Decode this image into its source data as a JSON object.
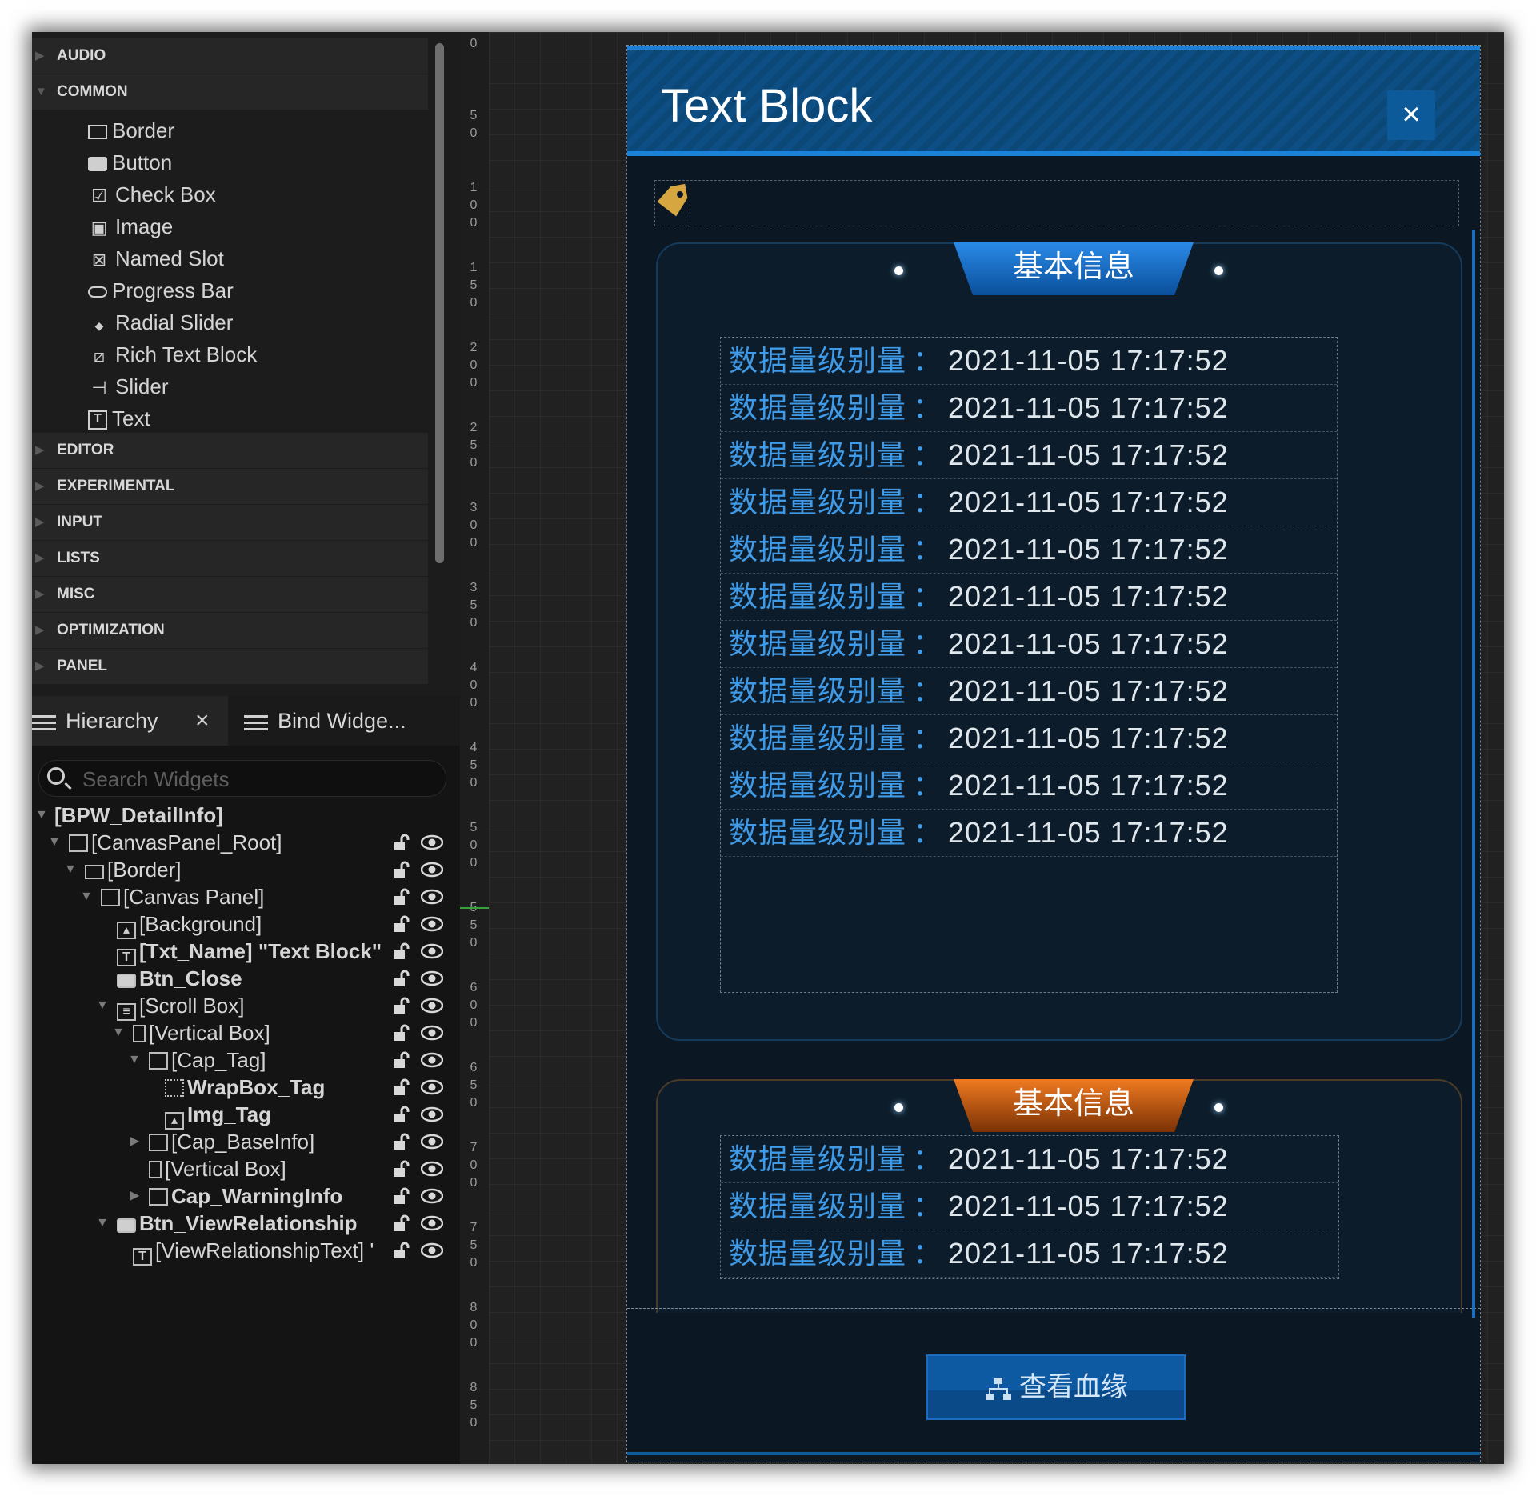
{
  "palette": {
    "categories_top": [
      {
        "label": "AUDIO"
      },
      {
        "label": "COMMON"
      }
    ],
    "common_items": [
      {
        "label": "Border",
        "icon": "border-icon"
      },
      {
        "label": "Button",
        "icon": "button-icon"
      },
      {
        "label": "Check Box",
        "icon": "checkbox-icon"
      },
      {
        "label": "Image",
        "icon": "image-icon"
      },
      {
        "label": "Named Slot",
        "icon": "named-slot-icon"
      },
      {
        "label": "Progress Bar",
        "icon": "progress-bar-icon"
      },
      {
        "label": "Radial Slider",
        "icon": "radial-slider-icon"
      },
      {
        "label": "Rich Text Block",
        "icon": "rich-text-icon"
      },
      {
        "label": "Slider",
        "icon": "slider-icon"
      },
      {
        "label": "Text",
        "icon": "text-icon"
      }
    ],
    "categories_bottom": [
      {
        "label": "EDITOR"
      },
      {
        "label": "EXPERIMENTAL"
      },
      {
        "label": "INPUT"
      },
      {
        "label": "LISTS"
      },
      {
        "label": "MISC"
      },
      {
        "label": "OPTIMIZATION"
      },
      {
        "label": "PANEL"
      }
    ]
  },
  "hierarchy": {
    "tab_hierarchy": "Hierarchy",
    "tab_close": "×",
    "tab_bind": "Bind Widge...",
    "search_placeholder": "Search Widgets",
    "tree": [
      {
        "label": "[BPW_DetailInfo]",
        "bold": true
      },
      {
        "label": "[CanvasPanel_Root]",
        "icon": "canvas-icon"
      },
      {
        "label": "[Border]",
        "icon": "border-icon"
      },
      {
        "label": "[Canvas Panel]",
        "icon": "canvas-icon"
      },
      {
        "label": "[Background]",
        "icon": "image-icon"
      },
      {
        "label": "[Txt_Name] \"Text Block\"",
        "icon": "text-icon",
        "bold": true
      },
      {
        "label": "Btn_Close",
        "icon": "button-icon",
        "bold": true
      },
      {
        "label": "[Scroll Box]",
        "icon": "scroll-box-icon"
      },
      {
        "label": "[Vertical Box]",
        "icon": "vertical-box-icon"
      },
      {
        "label": "[Cap_Tag]",
        "icon": "canvas-icon"
      },
      {
        "label": "WrapBox_Tag",
        "icon": "wrap-box-icon",
        "bold": true
      },
      {
        "label": "Img_Tag",
        "icon": "image-icon",
        "bold": true
      },
      {
        "label": "[Cap_BaseInfo]",
        "icon": "canvas-icon"
      },
      {
        "label": "[Vertical Box]",
        "icon": "vertical-box-icon"
      },
      {
        "label": "Cap_WarningInfo",
        "icon": "canvas-icon",
        "bold": true
      },
      {
        "label": "Btn_ViewRelationship",
        "icon": "button-icon",
        "bold": true
      },
      {
        "label": "[ViewRelationshipText] '",
        "icon": "text-icon"
      }
    ]
  },
  "ruler": {
    "ticks": [
      "0",
      "50",
      "100",
      "150",
      "200",
      "250",
      "300",
      "350",
      "400",
      "450",
      "500",
      "550",
      "600",
      "650",
      "700",
      "750",
      "800",
      "850"
    ]
  },
  "widget": {
    "title": "Text Block",
    "close_glyph": "×",
    "panel_title_blue": "基本信息",
    "panel_title_orange": "基本信息",
    "row_label": "数据量级别量",
    "row_colon": "：",
    "row_value": "2021-11-05 17:17:52",
    "view_button_label": "查看血缘",
    "colors": {
      "header": "#0d4f84",
      "accent_blue": "#2a8ae8",
      "accent_orange": "#f07a20",
      "label_blue": "#3f9be8"
    }
  }
}
